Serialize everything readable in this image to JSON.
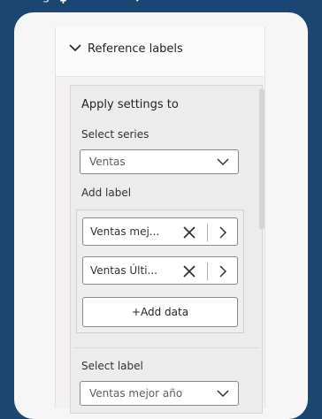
{
  "top_text": "ᵗᵉᵘᵍᵃ˖ᵘᵘᵘᵃᵉˢᵗᵉ˒ᵉᵃᵗᵃᵘ",
  "section": {
    "title": "Reference labels",
    "chevron_icon": "chevron-down-icon",
    "expanded": true
  },
  "apply_settings": {
    "heading": "Apply settings to",
    "select_series_label": "Select series",
    "series_value": "Ventas",
    "add_label_heading": "Add label",
    "labels": [
      {
        "name": "Ventas mej...",
        "remove_icon": "close-icon",
        "open_icon": "chevron-right-icon"
      },
      {
        "name": "Ventas Últi...",
        "remove_icon": "close-icon",
        "open_icon": "chevron-right-icon"
      }
    ],
    "add_data_label": "+Add data",
    "select_label_label": "Select label",
    "label_value": "Ventas mejor año"
  },
  "colors": {
    "background": "#1b4672",
    "panel": "#f3f2f1",
    "text": "#252423"
  }
}
